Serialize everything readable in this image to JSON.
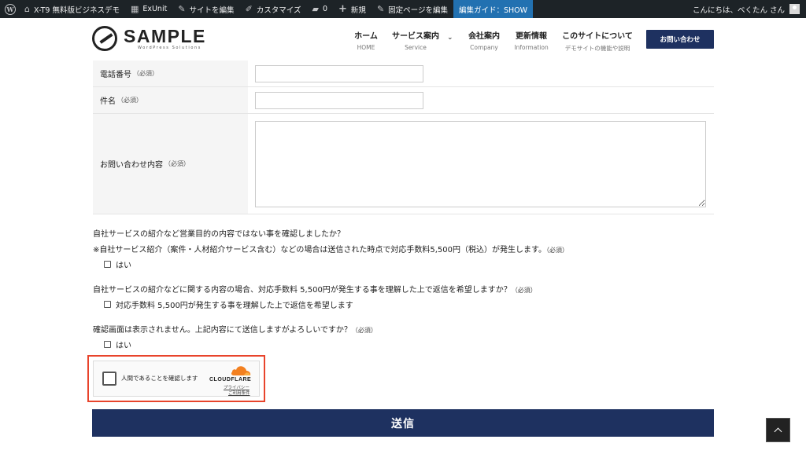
{
  "adminbar": {
    "items": [
      {
        "icon": "house-icon",
        "label": "X-T9 無料版ビジネスデモ"
      },
      {
        "icon": "exunit-icon",
        "label": "ExUnit"
      },
      {
        "icon": "edit-site-icon",
        "label": "サイトを編集"
      },
      {
        "icon": "brush-icon",
        "label": "カスタマイズ"
      },
      {
        "icon": "comment-icon",
        "label": "0"
      },
      {
        "icon": "plus-icon",
        "label": "新規"
      },
      {
        "icon": "pencil-icon",
        "label": "固定ページを編集"
      },
      {
        "icon": "",
        "label": "編集ガイド：SHOW"
      }
    ],
    "greeting": "こんにちは、べくたん さん"
  },
  "header": {
    "logo_name": "SAMPLE",
    "logo_sub": "WordPress Solutions",
    "nav": [
      {
        "label": "ホーム",
        "sub": "HOME"
      },
      {
        "label": "サービス案内",
        "sub": "Service"
      },
      {
        "label": "会社案内",
        "sub": "Company"
      },
      {
        "label": "更新情報",
        "sub": "Information"
      },
      {
        "label": "このサイトについて",
        "sub": "デモサイトの機能や説明"
      }
    ],
    "contact_label": "お問い合わせ"
  },
  "form": {
    "required": "（必須）",
    "fields": [
      {
        "label": "電話番号",
        "value": ""
      },
      {
        "label": "件名",
        "value": ""
      },
      {
        "label": "お問い合わせ内容",
        "value": ""
      }
    ],
    "q1_line1": "自社サービスの紹介など営業目的の内容ではない事を確認しましたか？",
    "q1_line2": "※自社サービス紹介（案件・人材紹介サービス含む）などの場合は送信された時点で対応手数料5,500円（税込）が発生します。",
    "q1_option": "はい",
    "q2": "自社サービスの紹介などに関する内容の場合、対応手数料 5,500円が発生する事を理解した上で返信を希望しますか？",
    "q2_option": "対応手数料 5,500円が発生する事を理解した上で返信を希望します",
    "q3": "確認画面は表示されません。上記内容にて送信しますがよろしいですか？",
    "q3_option": "はい",
    "submit_label": "送信"
  },
  "turnstile": {
    "label": "人間であることを確認します",
    "brand": "CLOUDFLARE",
    "privacy": "プライバシー",
    "terms": "ご利用条件",
    "cloud_color": "#f38020"
  }
}
